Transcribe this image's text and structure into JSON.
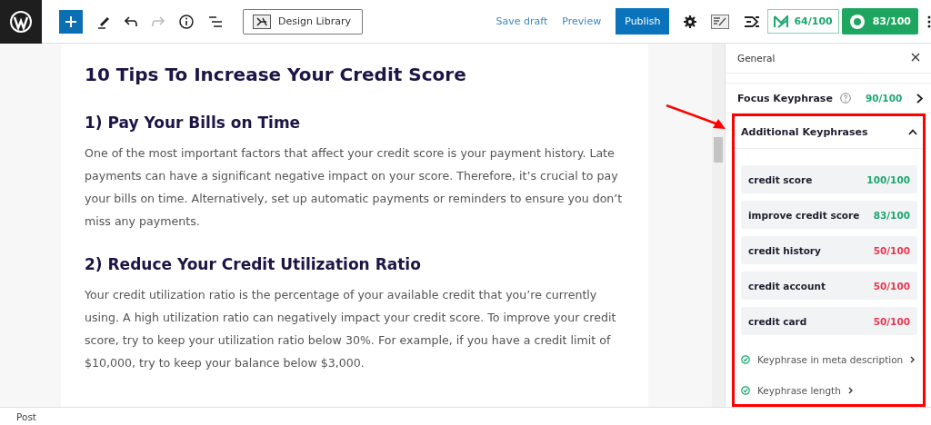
{
  "toolbar": {
    "design_library": "Design Library",
    "save_draft": "Save draft",
    "preview": "Preview",
    "publish": "Publish",
    "score_1": "64/100",
    "score_2": "83/100"
  },
  "article": {
    "title": "10 Tips To Increase Your Credit Score",
    "sections": [
      {
        "heading": "1) Pay Your Bills on Time",
        "text": "One of the most important factors that affect your credit score is your payment history. Late payments can have a significant negative impact on your score. Therefore, it’s crucial to pay your bills on time. Alternatively, set up automatic payments or reminders to ensure you don’t miss any payments."
      },
      {
        "heading": "2) Reduce Your Credit Utilization Ratio",
        "text": "Your credit utilization ratio is the percentage of your available credit that you’re currently using. A high utilization ratio can negatively impact your credit score. To improve your credit score, try to keep your utilization ratio below 30%. For example, if you have a credit limit of $10,000, try to keep your balance below $3,000."
      }
    ]
  },
  "sidebar": {
    "title": "General",
    "focus": {
      "label": "Focus Keyphrase",
      "score": "90/100"
    },
    "additional": {
      "label": "Additional Keyphrases",
      "expanded": true,
      "keyphrases": [
        {
          "name": "credit score",
          "score": "100/100",
          "color": "#1ea672"
        },
        {
          "name": "improve credit score",
          "score": "83/100",
          "color": "#1ea672"
        },
        {
          "name": "credit history",
          "score": "50/100",
          "color": "#e8384f"
        },
        {
          "name": "credit account",
          "score": "50/100",
          "color": "#e8384f"
        },
        {
          "name": "credit card",
          "score": "50/100",
          "color": "#e8384f"
        }
      ],
      "checks": [
        {
          "label": "Keyphrase in meta description"
        },
        {
          "label": "Keyphrase length"
        }
      ]
    }
  },
  "status_bar": {
    "label": "Post"
  }
}
